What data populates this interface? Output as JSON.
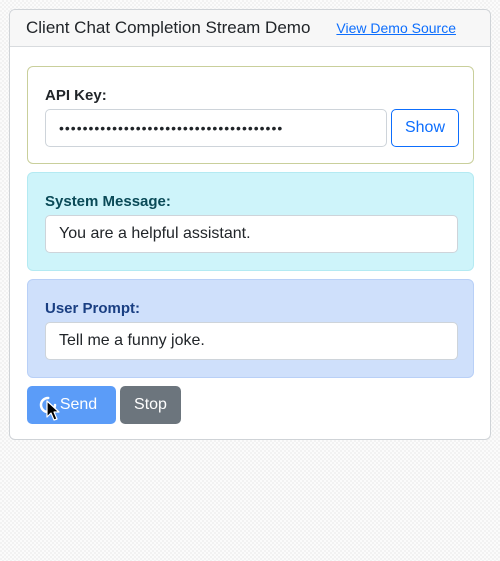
{
  "header": {
    "title": "Client Chat Completion Stream Demo",
    "source_link": "View Demo Source"
  },
  "api_key": {
    "label": "API Key:",
    "masked_value": "••••••••••••••••••••••••••••••••••••••",
    "show_label": "Show"
  },
  "system_message": {
    "label": "System Message:",
    "value": "You are a helpful assistant."
  },
  "user_prompt": {
    "label": "User Prompt:",
    "value": "Tell me a funny joke."
  },
  "actions": {
    "send_label": "Send",
    "stop_label": "Stop"
  },
  "colors": {
    "primary": "#0d6efd",
    "send_loading": "#5b9cf8",
    "stop": "#6c757d",
    "system_panel": "#cef4fa",
    "user_panel": "#cfe0fb"
  },
  "icons": {
    "spinner": "loading-spinner-icon",
    "cursor": "mouse-pointer-icon"
  }
}
